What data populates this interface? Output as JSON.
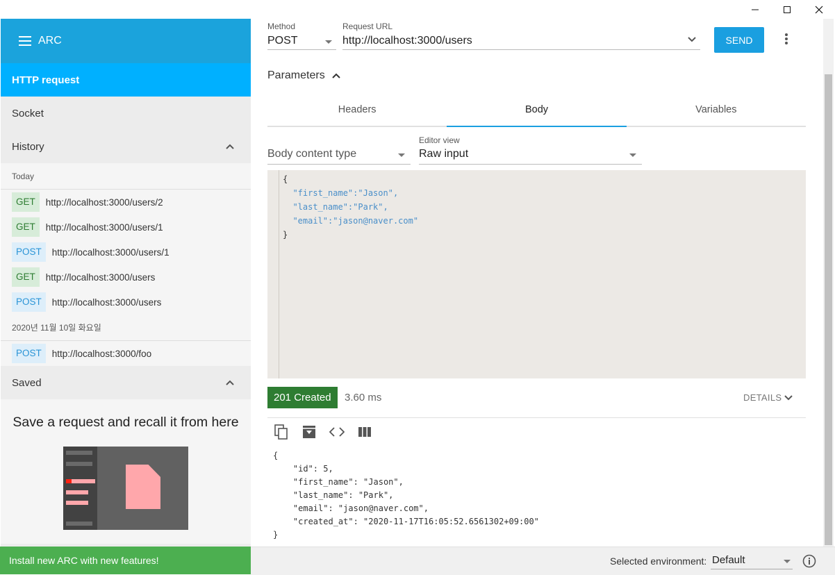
{
  "window": {
    "minimize_icon": "minimize-icon",
    "maximize_icon": "maximize-icon",
    "close_icon": "close-icon"
  },
  "sidebar": {
    "app_title": "ARC",
    "nav_active": "HTTP request",
    "nav_socket": "Socket",
    "history_label": "History",
    "history_groups": [
      {
        "day": "Today",
        "items": [
          {
            "method": "GET",
            "url": "http://localhost:3000/users/2"
          },
          {
            "method": "GET",
            "url": "http://localhost:3000/users/1"
          },
          {
            "method": "POST",
            "url": "http://localhost:3000/users/1"
          },
          {
            "method": "GET",
            "url": "http://localhost:3000/users"
          },
          {
            "method": "POST",
            "url": "http://localhost:3000/users"
          }
        ]
      },
      {
        "day": "2020년 11월 10일 화요일",
        "items": [
          {
            "method": "POST",
            "url": "http://localhost:3000/foo"
          }
        ]
      }
    ],
    "saved_label": "Saved",
    "saved_empty_title": "Save a request and recall it from here",
    "install_banner": "Install new ARC with new features!"
  },
  "request": {
    "method_label": "Method",
    "method_value": "POST",
    "url_label": "Request URL",
    "url_value": "http://localhost:3000/users",
    "send_label": "SEND",
    "parameters_label": "Parameters",
    "tabs": [
      "Headers",
      "Body",
      "Variables"
    ],
    "active_tab": "Body",
    "body_content_type_label": "Body content type",
    "editor_view_label": "Editor view",
    "editor_view_value": "Raw input",
    "body_lines": [
      "{",
      "  \"first_name\":\"Jason\",",
      "  \"last_name\":\"Park\",",
      "  \"email\":\"jason@naver.com\"",
      "}"
    ]
  },
  "response": {
    "status": "201 Created",
    "time": "3.60 ms",
    "details_label": "DETAILS",
    "tools": [
      "copy-icon",
      "save-icon",
      "code-icon",
      "columns-icon"
    ],
    "lines": [
      "{",
      "    \"id\": 5,",
      "    \"first_name\": \"Jason\",",
      "    \"last_name\": \"Park\",",
      "    \"email\": \"jason@naver.com\",",
      "    \"created_at\": \"2020-11-17T16:05:52.6561302+09:00\"",
      "}"
    ]
  },
  "footer": {
    "env_label": "Selected environment:",
    "env_value": "Default"
  },
  "colors": {
    "accent": "#1a9fe0",
    "app_bar": "#1ba3dc",
    "nav_active": "#00b0ff",
    "status_ok": "#2e7d32",
    "install": "#4caf50"
  }
}
